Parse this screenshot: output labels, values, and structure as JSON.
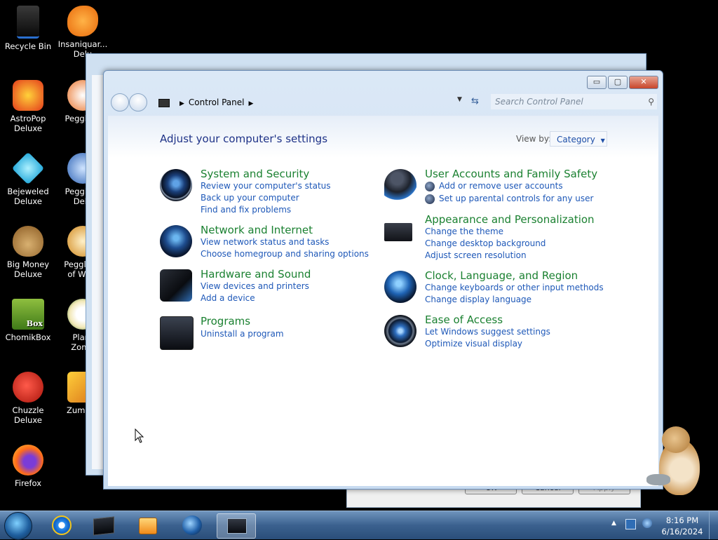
{
  "desktop": {
    "icons": [
      {
        "label": "Recycle Bin"
      },
      {
        "label": "Insaniquar...\nDelu"
      },
      {
        "label": "AstroPop\nDeluxe"
      },
      {
        "label": "Peggle D"
      },
      {
        "label": "Bejeweled\nDeluxe"
      },
      {
        "label": "Peggle N\nDelu"
      },
      {
        "label": "Big Money\nDeluxe"
      },
      {
        "label": "Peggle W\nof Warc"
      },
      {
        "label": "ChomikBox"
      },
      {
        "label": "Plant\nZomb"
      },
      {
        "label": "Chuzzle\nDeluxe"
      },
      {
        "label": "Zuma D"
      },
      {
        "label": "Firefox"
      }
    ],
    "chomik_badge": "Box"
  },
  "background_dialog": {
    "ok_label": "OK",
    "cancel_label": "Cancel",
    "apply_label": "Apply"
  },
  "window": {
    "controls": {
      "minimize": "▭",
      "maximize": "▢",
      "close": "✕"
    },
    "address": {
      "location": "Control Panel"
    },
    "search": {
      "placeholder": "Search Control Panel"
    },
    "heading": "Adjust your computer's settings",
    "view_by_label": "View by:",
    "view_by_value": "Category",
    "categories": [
      {
        "title": "System and Security",
        "links": [
          "Review your computer's status",
          "Back up your computer",
          "Find and fix problems"
        ]
      },
      {
        "title": "Network and Internet",
        "links": [
          "View network status and tasks",
          "Choose homegroup and sharing options"
        ]
      },
      {
        "title": "Hardware and Sound",
        "links": [
          "View devices and printers",
          "Add a device"
        ]
      },
      {
        "title": "Programs",
        "links": [
          "Uninstall a program"
        ]
      },
      {
        "title": "User Accounts and Family Safety",
        "links": [
          "Add or remove user accounts",
          "Set up parental controls for any user"
        ]
      },
      {
        "title": "Appearance and Personalization",
        "links": [
          "Change the theme",
          "Change desktop background",
          "Adjust screen resolution"
        ]
      },
      {
        "title": "Clock, Language, and Region",
        "links": [
          "Change keyboards or other input methods",
          "Change display language"
        ]
      },
      {
        "title": "Ease of Access",
        "links": [
          "Let Windows suggest settings",
          "Optimize visual display"
        ]
      }
    ]
  },
  "taskbar": {
    "items": [
      "internet-explorer",
      "control-panel-dark",
      "media-player",
      "globe",
      "control-panel-active"
    ],
    "time": "8:16 PM",
    "date": "6/16/2024"
  },
  "colors": {
    "category_title": "#1b8131",
    "link": "#1e58b8",
    "heading": "#1e3287"
  }
}
